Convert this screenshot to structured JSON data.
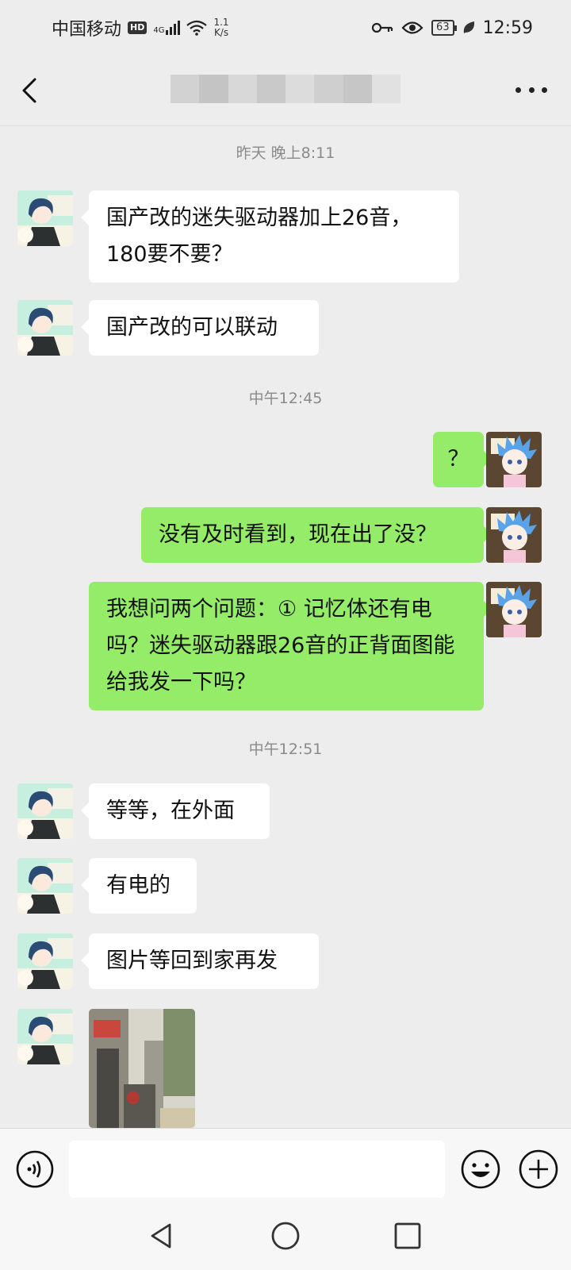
{
  "status": {
    "carrier": "中国移动",
    "hd": "HD",
    "network": "4G",
    "speed_value": "1.1",
    "speed_unit": "K/s",
    "battery": "63",
    "time": "12:59"
  },
  "header": {
    "contact_name": ""
  },
  "chat": {
    "timestamps": [
      "昨天 晚上8:11",
      "中午12:45",
      "中午12:51"
    ],
    "messages": [
      {
        "side": "left",
        "text": "国产改的迷失驱动器加上26音，180要不要？"
      },
      {
        "side": "left",
        "text": "国产改的可以联动"
      },
      {
        "side": "right",
        "text": "？"
      },
      {
        "side": "right",
        "text": "没有及时看到，现在出了没？"
      },
      {
        "side": "right",
        "text": "我想问两个问题：① 记忆体还有电吗？迷失驱动器跟26音的正背面图能给我发一下吗？"
      },
      {
        "side": "left",
        "text": "等等，在外面"
      },
      {
        "side": "left",
        "text": "有电的"
      },
      {
        "side": "left",
        "text": "图片等回到家再发"
      }
    ]
  },
  "colors": {
    "background": "#ededed",
    "sent_bubble": "#95ec69",
    "received_bubble": "#ffffff"
  },
  "icons": {
    "back": "chevron-left-icon",
    "more": "more-icon",
    "voice": "voice-icon",
    "emoji": "emoji-icon",
    "plus": "plus-icon"
  }
}
